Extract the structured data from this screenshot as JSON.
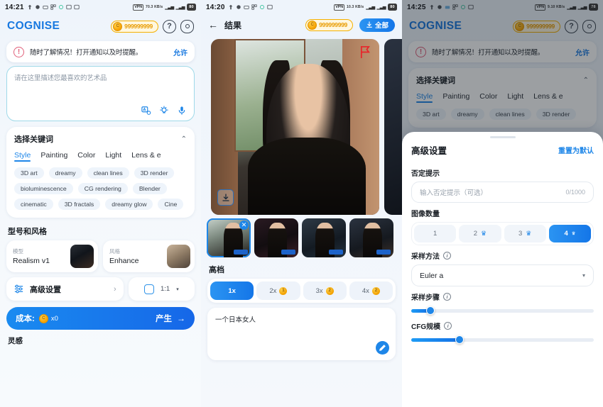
{
  "panel1": {
    "statusbar": {
      "time": "14:21",
      "vpn": "VPN",
      "net_speed": "70.3 KB/s",
      "battery": "80"
    },
    "header": {
      "logo": "COGNISE",
      "credits": "999999999",
      "help_icon": "question-mark-icon",
      "settings_icon": "gear-icon"
    },
    "notice": {
      "icon": "exclamation-icon",
      "text": "随时了解情况！打开通知以及时提醒。",
      "action": "允许"
    },
    "prompt": {
      "placeholder": "请在这里描述您最喜欢的艺术品",
      "tools": [
        "translate-icon",
        "idea-icon",
        "mic-icon"
      ]
    },
    "keywords": {
      "title": "选择关键词",
      "collapse_icon": "chevron-up-icon",
      "tabs": [
        "Style",
        "Painting",
        "Color",
        "Light",
        "Lens & e"
      ],
      "active_tab": "Style",
      "chip_rows": [
        [
          "3D art",
          "dreamy",
          "clean lines",
          "3D render"
        ],
        [
          "bioluminescence",
          "CG rendering",
          "Blender"
        ],
        [
          "cinematic",
          "3D fractals",
          "dreamy glow",
          "Cine"
        ]
      ]
    },
    "model_section": {
      "title": "型号和风格",
      "model_label": "模型",
      "model_value": "Realism v1",
      "style_label": "风格",
      "style_value": "Enhance"
    },
    "advanced": {
      "label": "高级设置",
      "icon": "sliders-icon",
      "chevron": "›"
    },
    "ratio": {
      "icon": "aspect-ratio-icon",
      "value": "1:1",
      "caret": "▾"
    },
    "generate": {
      "cost_label": "成本:",
      "cost_value": "x0",
      "action": "产生",
      "arrow": "→"
    },
    "inspiration_title": "灵感"
  },
  "panel2": {
    "statusbar": {
      "time": "14:20",
      "vpn": "VPN",
      "net_speed": "10.3 KB/s",
      "battery": "80"
    },
    "header": {
      "back_icon": "back-arrow-icon",
      "title": "结果",
      "credits": "999999999",
      "download_all": "全部",
      "download_icon": "download-icon"
    },
    "hero": {
      "flag_icon": "red-flag-icon",
      "download_icon": "download-icon"
    },
    "thumbnails": [
      {
        "selected": true,
        "close_icon": "close-icon"
      },
      {
        "selected": false
      },
      {
        "selected": false
      },
      {
        "selected": false
      }
    ],
    "upscale": {
      "title": "高档",
      "options": [
        {
          "label": "1x",
          "selected": true,
          "cost": null
        },
        {
          "label": "2x",
          "selected": false,
          "cost": "1"
        },
        {
          "label": "3x",
          "selected": false,
          "cost": "2"
        },
        {
          "label": "4x",
          "selected": false,
          "cost": "2"
        }
      ]
    },
    "prompt": {
      "text": "一个日本女人",
      "edit_icon": "pencil-icon"
    }
  },
  "panel3": {
    "statusbar": {
      "time": "14:25",
      "vpn": "VPN",
      "net_speed": "9.10 KB/s",
      "battery": "78"
    },
    "header": {
      "logo": "COGNISE",
      "credits": "999999999",
      "help_icon": "question-mark-icon",
      "settings_icon": "gear-icon"
    },
    "notice": {
      "icon": "exclamation-icon",
      "text": "随时了解情况！打开通知以及时提醒。",
      "action": "允许"
    },
    "keywords": {
      "title": "选择关键词",
      "collapse_icon": "chevron-up-icon",
      "tabs": [
        "Style",
        "Painting",
        "Color",
        "Light",
        "Lens & e"
      ],
      "active_tab": "Style",
      "chips": [
        "3D art",
        "dreamy",
        "clean lines",
        "3D render"
      ]
    },
    "sheet": {
      "title": "高级设置",
      "reset": "重置为默认",
      "negative_prompt": {
        "label": "否定提示",
        "placeholder": "输入否定提示（可选）",
        "counter": "0/1000"
      },
      "image_count": {
        "label": "图像数量",
        "options": [
          {
            "label": "1",
            "selected": false,
            "crown": false
          },
          {
            "label": "2",
            "selected": false,
            "crown": true
          },
          {
            "label": "3",
            "selected": false,
            "crown": true
          },
          {
            "label": "4",
            "selected": true,
            "crown": true
          }
        ]
      },
      "sampler": {
        "label": "采样方法",
        "info_icon": "info-icon",
        "value": "Euler a",
        "caret": "▾"
      },
      "steps": {
        "label": "采样步骤",
        "info_icon": "info-icon",
        "percent": 10
      },
      "cfg": {
        "label": "CFG规模",
        "info_icon": "info-icon",
        "percent": 26
      }
    }
  }
}
